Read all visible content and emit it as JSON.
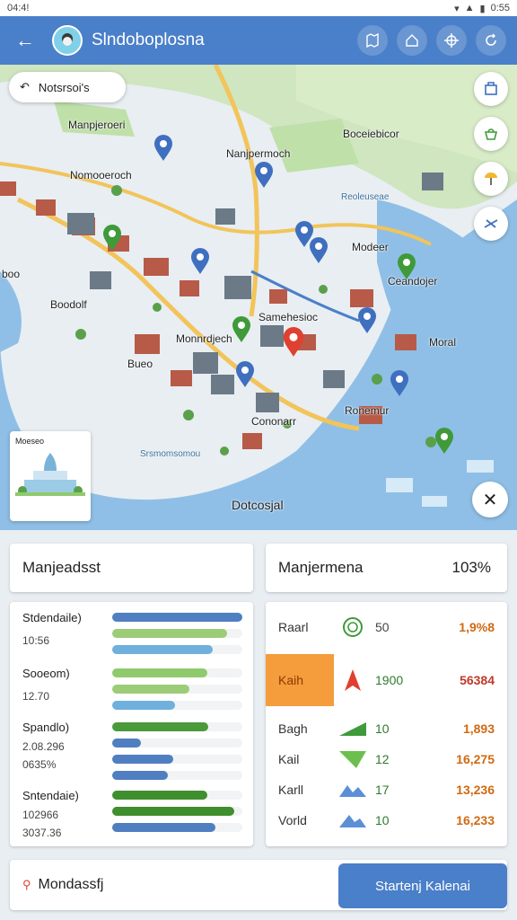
{
  "status_bar": {
    "time": "04:4!",
    "battery": "0:55"
  },
  "app_bar": {
    "title": "Slndoboplosna"
  },
  "map": {
    "search_text": "Notsrsoi's",
    "labels": {
      "top_left": "Manpjeroeri",
      "center_top": "Nanjpermoch",
      "left_mid": "Nomooeroch",
      "top_right": "Boceiebicor",
      "top_right_sub": "Reoleuseae",
      "right_mid": "Modeer",
      "right_mid_sub": "Ceandojer",
      "far_left": "boo",
      "left_lower": "Boodolf",
      "center": "Samehesioc",
      "center_left": "Monnrdjech",
      "center_lower": "Cononarr",
      "right_lower": "Moral",
      "right_bottom": "Ronemur",
      "left_bottom": "Bueo",
      "bottom": "Dotcosjal",
      "bottom_sub": "Srsmomsomou",
      "thumb_title": "Moeseo"
    }
  },
  "left_card": {
    "title": "Manjeadsst",
    "groups": [
      {
        "label": "Stdendaile)",
        "value": "10:56",
        "bars": [
          {
            "fill": 1.0,
            "color": "#4f7fc0"
          },
          {
            "fill": 0.88,
            "color": "#9ccc78"
          },
          {
            "fill": 0.77,
            "color": "#6fb0dd"
          }
        ]
      },
      {
        "label": "Sooeom)",
        "value": "12.70",
        "bars": [
          {
            "fill": 0.73,
            "color": "#8fca6c"
          },
          {
            "fill": 0.59,
            "color": "#9ccc78"
          },
          {
            "fill": 0.48,
            "color": "#6fb0dd"
          }
        ]
      },
      {
        "label": "Spandlo)",
        "value": "2.08.296",
        "value2": "0635%",
        "bars": [
          {
            "fill": 0.74,
            "color": "#4a9a3a"
          },
          {
            "fill": 0.22,
            "color": "#4f7fc0"
          },
          {
            "fill": 0.47,
            "color": "#4f7fc0"
          },
          {
            "fill": 0.43,
            "color": "#4f7fc0"
          }
        ]
      },
      {
        "label": "Sntendaie)",
        "value": "102966",
        "value2": "3037.36",
        "bars": [
          {
            "fill": 0.73,
            "color": "#3f8f2e"
          },
          {
            "fill": 0.94,
            "color": "#3f8f2e"
          },
          {
            "fill": 0.79,
            "color": "#4f7fc0"
          }
        ]
      }
    ]
  },
  "right_card": {
    "title": "Manjermena",
    "title_value": "103%",
    "rows": [
      {
        "label": "Raarl",
        "icon": "ring-icon",
        "value": "50",
        "total": "1,9%8"
      },
      {
        "label": "Kaih",
        "icon": "arrow-up-icon",
        "value": "1900",
        "total": "56384"
      },
      {
        "label": "Bagh",
        "icon": "trend-up-icon",
        "value": "10",
        "total": "1,893"
      },
      {
        "label": "Kail",
        "icon": "trend-down-icon",
        "value": "12",
        "total": "16,275"
      },
      {
        "label": "Karll",
        "icon": "wave-icon",
        "value": "17",
        "total": "13,236"
      },
      {
        "label": "Vorld",
        "icon": "wave-icon",
        "value": "10",
        "total": "16,233"
      }
    ]
  },
  "bottom_bar": {
    "label": "Mondassfj",
    "button_label": "Startenj Kalenai"
  },
  "colors": {
    "primary": "#4a7fc9",
    "accent_orange": "#f59c3d",
    "value_green": "#2f7a2f",
    "total_orange": "#d06a12"
  }
}
